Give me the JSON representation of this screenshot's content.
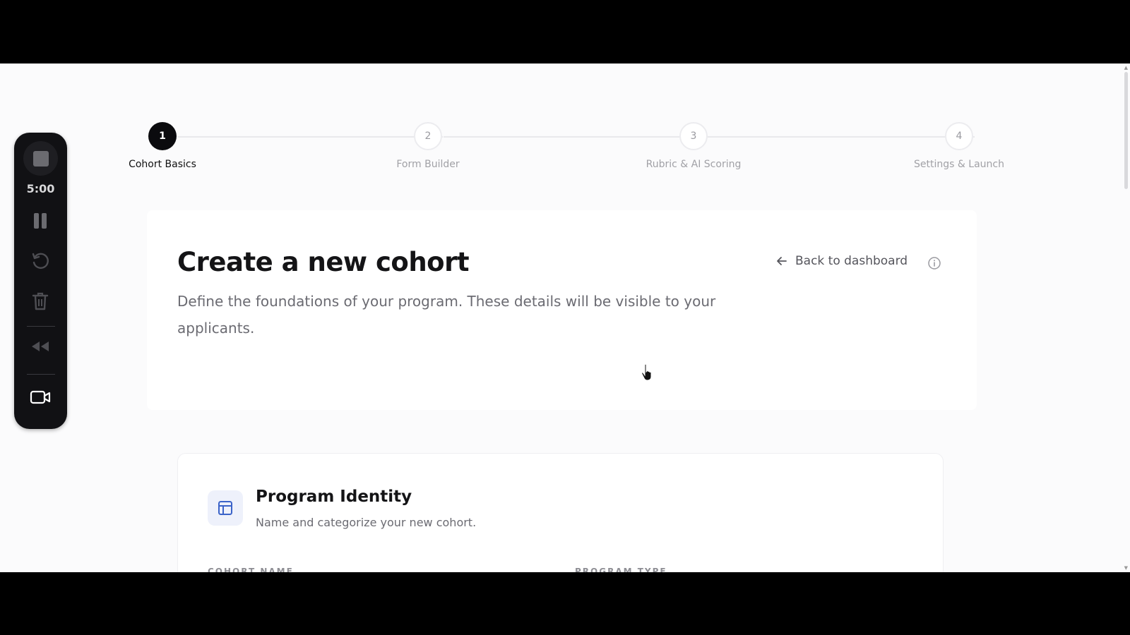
{
  "recorder": {
    "timer": "5:00",
    "controls": [
      "stop-icon",
      "pause-icon",
      "restart-icon",
      "trash-icon",
      "rewind-icon",
      "camera-icon"
    ]
  },
  "stepper": {
    "steps": [
      {
        "number": "1",
        "label": "Cohort Basics",
        "active": true
      },
      {
        "number": "2",
        "label": "Form Builder",
        "active": false
      },
      {
        "number": "3",
        "label": "Rubric & AI Scoring",
        "active": false
      },
      {
        "number": "4",
        "label": "Settings & Launch",
        "active": false
      }
    ]
  },
  "header": {
    "title": "Create a new cohort",
    "subtitle": "Define the foundations of your program. These details will be visible to your applicants.",
    "back_label": "Back to dashboard"
  },
  "identity": {
    "title": "Program Identity",
    "description": "Name and categorize your new cohort.",
    "fields": {
      "cohort_name_label": "COHORT NAME",
      "program_type_label": "PROGRAM TYPE"
    }
  },
  "colors": {
    "accent": "#0b0b0e",
    "icon_accent": "#3b63c9",
    "recorder_bg": "#111114"
  }
}
